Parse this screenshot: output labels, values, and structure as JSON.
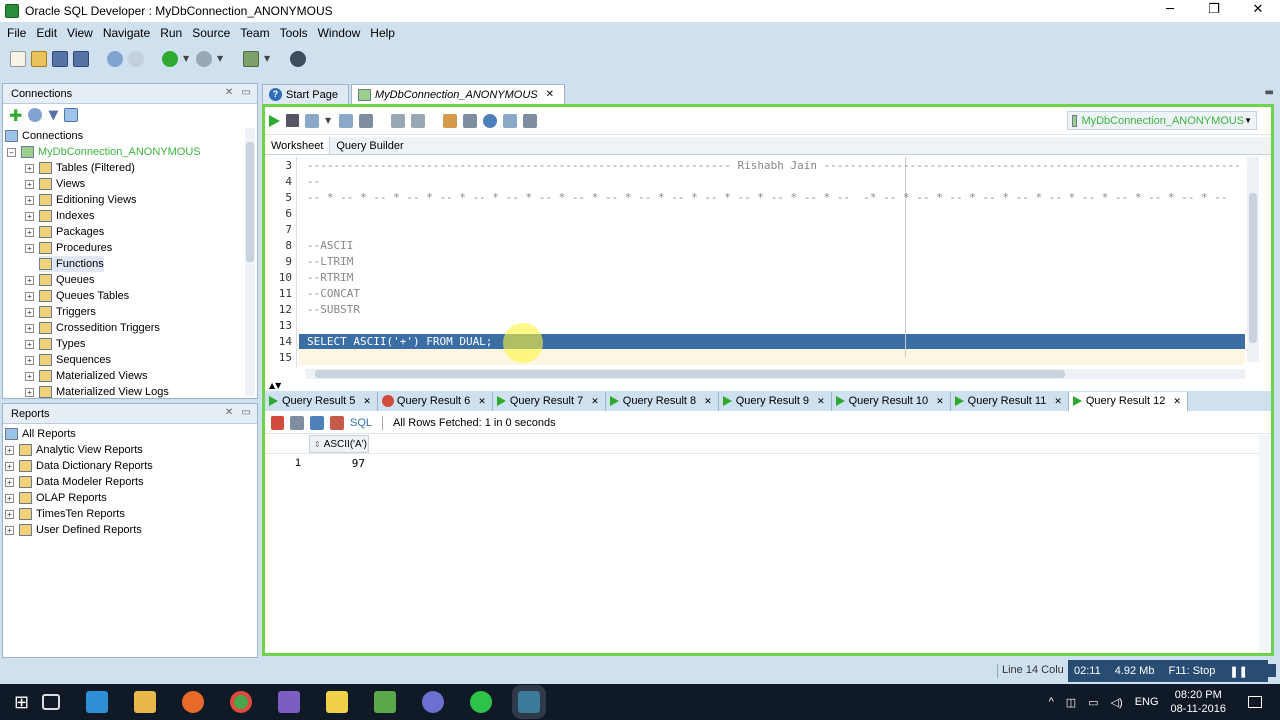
{
  "window": {
    "title": "Oracle SQL Developer : MyDbConnection_ANONYMOUS",
    "min": "─",
    "max": "❐",
    "close": "✕"
  },
  "menu": [
    "File",
    "Edit",
    "View",
    "Navigate",
    "Run",
    "Source",
    "Team",
    "Tools",
    "Window",
    "Help"
  ],
  "connections_panel": {
    "title": "Connections",
    "root": "Connections",
    "connection": "MyDbConnection_ANONYMOUS",
    "nodes": [
      "Tables (Filtered)",
      "Views",
      "Editioning Views",
      "Indexes",
      "Packages",
      "Procedures",
      "Functions",
      "Queues",
      "Queues Tables",
      "Triggers",
      "Crossedition Triggers",
      "Types",
      "Sequences",
      "Materialized Views",
      "Materialized View Logs"
    ]
  },
  "reports_panel": {
    "title": "Reports",
    "root": "All Reports",
    "items": [
      "Analytic View Reports",
      "Data Dictionary Reports",
      "Data Modeler Reports",
      "OLAP Reports",
      "TimesTen Reports",
      "User Defined Reports"
    ]
  },
  "editor_tabs": [
    "Start Page",
    "MyDbConnection_ANONYMOUS"
  ],
  "connection_selector": "MyDbConnection_ANONYMOUS",
  "sheet_tabs": [
    "Worksheet",
    "Query Builder"
  ],
  "code_lines": [
    {
      "n": "3",
      "t": "---------------------------------------------------------------- Rishabh Jain ----------------------------------------------------------------"
    },
    {
      "n": "4",
      "t": "--"
    },
    {
      "n": "5",
      "t": "-- * -- * -- * -- * -- * -- * -- * -- * -- * -- * -- * -- * -- * -- * -- * -- * --  -* -- * -- * -- * -- * -- * -- * -- * -- * -- * -- * --"
    },
    {
      "n": "6",
      "t": ""
    },
    {
      "n": "7",
      "t": ""
    },
    {
      "n": "8",
      "t": "--ASCII"
    },
    {
      "n": "9",
      "t": "--LTRIM"
    },
    {
      "n": "10",
      "t": "--RTRIM"
    },
    {
      "n": "11",
      "t": "--CONCAT"
    },
    {
      "n": "12",
      "t": "--SUBSTR"
    },
    {
      "n": "13",
      "t": ""
    },
    {
      "n": "14",
      "t": "SELECT ASCII('+') FROM DUAL;"
    },
    {
      "n": "15",
      "t": ""
    }
  ],
  "result_tabs": [
    "Query Result 5",
    "Query Result 6",
    "Query Result 7",
    "Query Result 8",
    "Query Result 9",
    "Query Result 10",
    "Query Result 11",
    "Query Result 12"
  ],
  "result_toolbar": {
    "sql": "SQL",
    "status": "All Rows Fetched: 1 in 0 seconds"
  },
  "grid": {
    "column": "ASCII('A')",
    "row_num": "1",
    "value": "97"
  },
  "statusbar": {
    "line": "Line 14 Colu",
    "time": "02:11",
    "memory": "4.92 Mb",
    "f11": "F11: Stop"
  },
  "taskbar": {
    "lang": "ENG",
    "clock_time": "08:20 PM",
    "clock_date": "08-11-2016"
  }
}
